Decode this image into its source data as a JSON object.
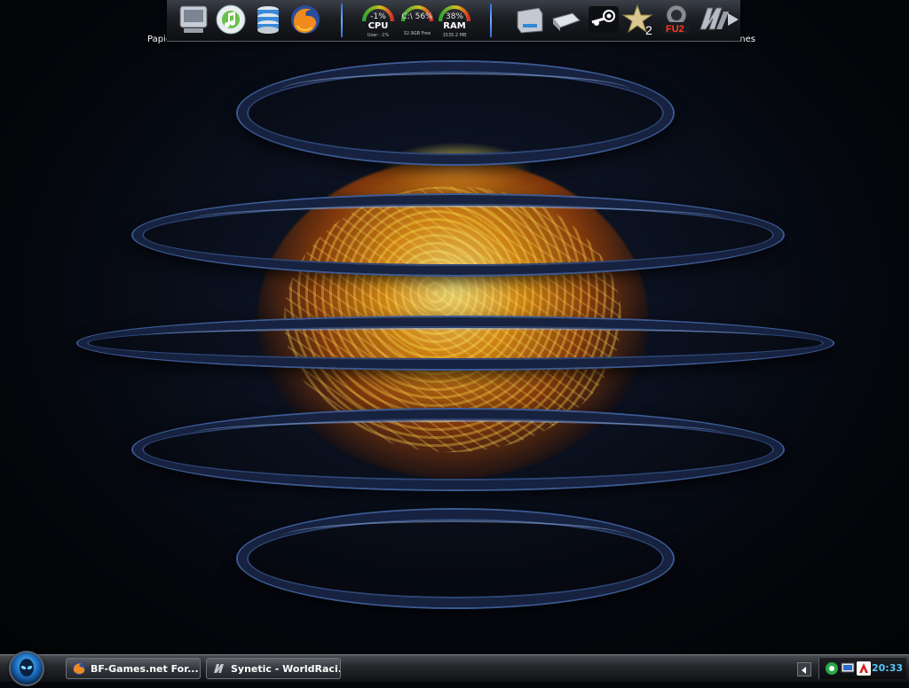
{
  "desktop": {
    "icons": [
      {
        "label": "Papierkorb"
      },
      {
        "label": "Games"
      }
    ]
  },
  "dock": {
    "left_icons": [
      "computer-icon",
      "itunes-icon",
      "database-icon",
      "firefox-icon"
    ],
    "gauges": [
      {
        "percent": "-1%",
        "label": "CPU",
        "sub": "User: -1%",
        "level": 0.05
      },
      {
        "percent": "C:\\ 56%",
        "label": "",
        "sub": "32.9GB Free",
        "level": 0.56
      },
      {
        "percent": "38%",
        "label": "RAM",
        "sub": "1535.2 MB",
        "level": 0.38
      }
    ],
    "right_icons": [
      "drive-icon",
      "network-cable-icon",
      "steam-icon",
      "star-icon",
      "fifa-icon",
      "wrc-icon",
      "arrow-right-icon"
    ],
    "star_badge": "2",
    "fu2_text": "FU2"
  },
  "taskbar": {
    "tasks": [
      {
        "label": "BF-Games.net For...",
        "icon": "firefox-icon"
      },
      {
        "label": "Synetic - WorldRaci...",
        "icon": "app-icon"
      }
    ],
    "clock": "20:33"
  },
  "colors": {
    "accent_blue": "#58c8ff",
    "separator_blue": "#4a90ff",
    "flame": "#f0a020"
  }
}
